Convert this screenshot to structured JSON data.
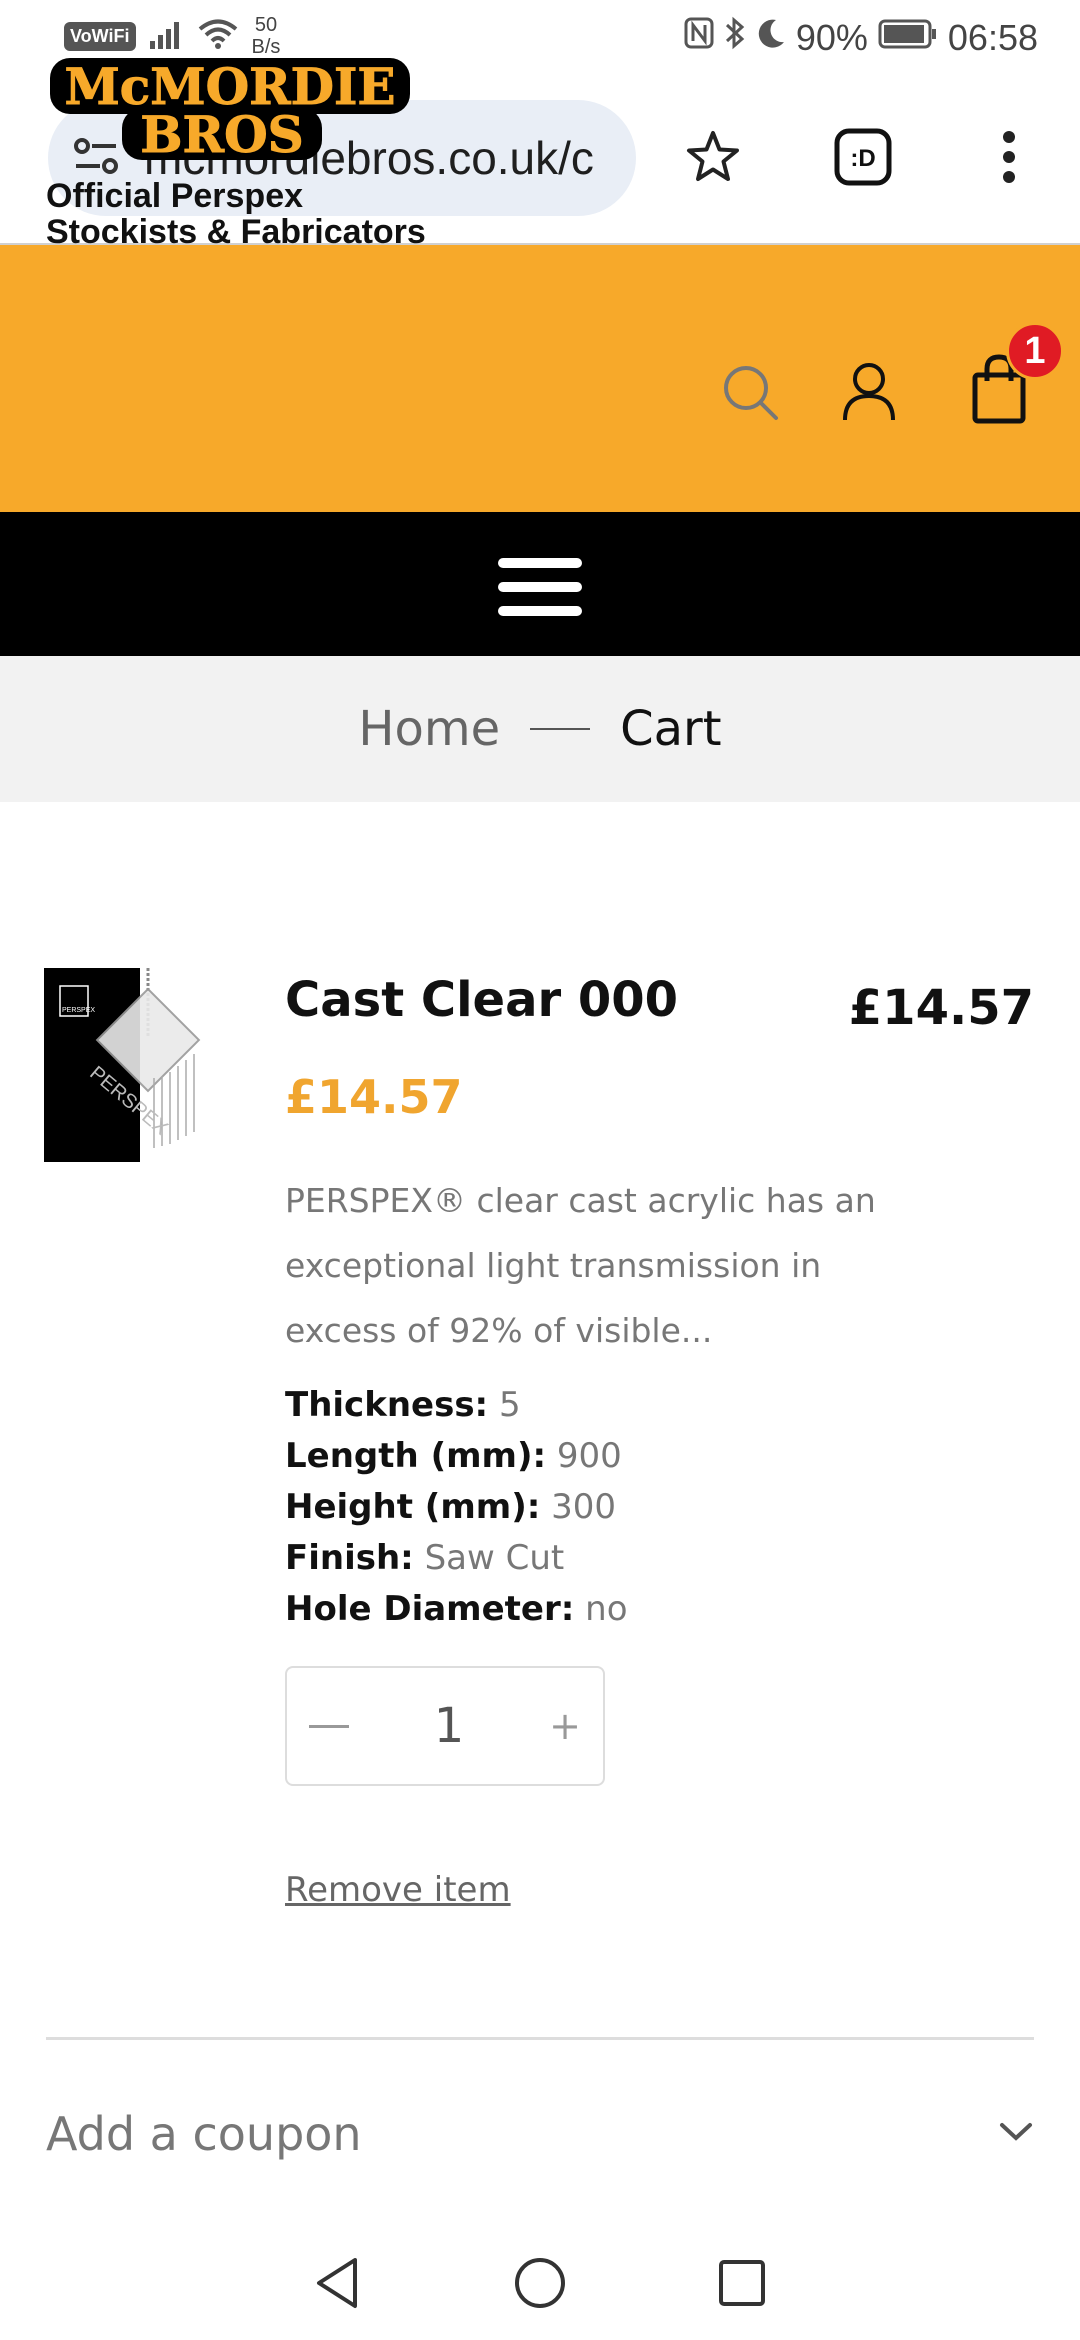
{
  "status_bar": {
    "vowifi": "VoWiFi",
    "speed_value": "50",
    "speed_unit": "B/s",
    "battery": "90%",
    "time": "06:58"
  },
  "browser": {
    "url": "mcmordiebros.co.uk/c",
    "icons": [
      "site-settings-icon",
      "bookmark-star-icon",
      "extension-icon",
      "overflow-menu-icon"
    ],
    "extension_label": ":D"
  },
  "header": {
    "logo_line1": "McMORDIE",
    "logo_line2": "BROS",
    "tagline_line1": "Official Perspex",
    "tagline_line2": "Stockists & Fabricators",
    "cart_count": "1",
    "brand_color": "#f7a92a",
    "badge_color": "#e01b24"
  },
  "breadcrumb": {
    "home": "Home",
    "current": "Cart"
  },
  "cart": {
    "item": {
      "name": "Cast Clear 000",
      "line_total": "£14.57",
      "price": "£14.57",
      "thumbnail_label": "PERSPEX",
      "description": "PERSPEX® clear cast acrylic has an exceptional light transmission in excess of 92% of visible...",
      "meta": [
        {
          "key": "Thickness:",
          "value": "5"
        },
        {
          "key": "Length (mm):",
          "value": "900"
        },
        {
          "key": "Height (mm):",
          "value": "300"
        },
        {
          "key": "Finish:",
          "value": "Saw Cut"
        },
        {
          "key": "Hole Diameter:",
          "value": "no"
        }
      ],
      "quantity": "1",
      "remove_label": "Remove item"
    },
    "coupon_label": "Add a coupon",
    "price_color": "#f0a52f"
  }
}
